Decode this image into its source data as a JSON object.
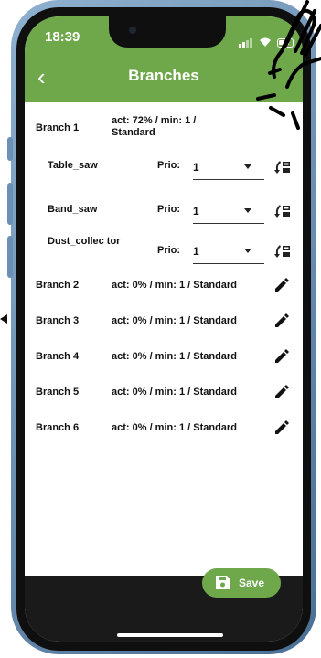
{
  "status": {
    "time": "18:39"
  },
  "appbar": {
    "title": "Branches",
    "back_icon": "back-arrow-icon"
  },
  "branches": [
    {
      "name": "Branch 1",
      "status": "act: 72% / min: 1 / Standard"
    },
    {
      "name": "Branch 2",
      "status": "act: 0% / min: 1 / Standard"
    },
    {
      "name": "Branch 3",
      "status": "act: 0% / min: 1 / Standard"
    },
    {
      "name": "Branch 4",
      "status": "act: 0% / min: 1 / Standard"
    },
    {
      "name": "Branch 5",
      "status": "act: 0% / min: 1 / Standard"
    },
    {
      "name": "Branch 6",
      "status": "act: 0% / min: 1 / Standard"
    }
  ],
  "consumers": [
    {
      "name": "Table_saw",
      "prio_label": "Prio:",
      "prio": "1"
    },
    {
      "name": "Band_saw",
      "prio_label": "Prio:",
      "prio": "1"
    },
    {
      "name": "Dust_collec tor",
      "prio_label": "Prio:",
      "prio": "1"
    }
  ],
  "footer": {
    "save_label": "Save"
  },
  "colors": {
    "accent": "#6ea84b",
    "bottom_bar": "#1a1a1a"
  }
}
